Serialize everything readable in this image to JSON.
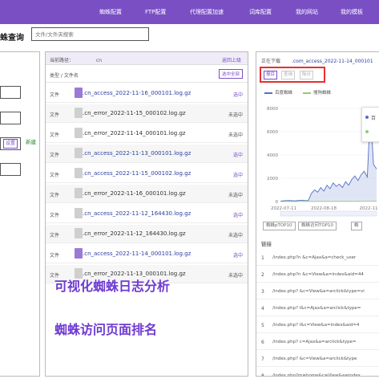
{
  "nav": {
    "items": [
      "蜘蛛配置",
      "FTP配置",
      "代理配置加速",
      "词库配置",
      "我的网站",
      "我的模板"
    ]
  },
  "page": {
    "title": "蛛查询",
    "search_placeholder": "文件/文件夹搜索"
  },
  "left_panel": {
    "settings_label": "设置",
    "new_label": "新建"
  },
  "file_panel": {
    "current_path_label": "当前路径：",
    "current_path_value": "cn",
    "back_label": "返回上级",
    "column_label": "类型 / 文件名",
    "select_all_label": "选中全部",
    "files": [
      {
        "type": "文件",
        "name": ".cn_access_2022-11-16_000101.log.gz",
        "status": "选中",
        "selected": true,
        "icon_color": "#9b7ad6"
      },
      {
        "type": "文件",
        "name": ".cn_error_2022-11-15_000102.log.gz",
        "status": "未选中",
        "selected": false,
        "icon_color": "#cfcfcf"
      },
      {
        "type": "文件",
        "name": ".cn_error_2022-11-14_000101.log.gz",
        "status": "未选中",
        "selected": false,
        "icon_color": "#cfcfcf"
      },
      {
        "type": "文件",
        "name": ".cn_access_2022-11-13_000101.log.gz",
        "status": "选中",
        "selected": true,
        "icon_color": "#cfcfcf"
      },
      {
        "type": "文件",
        "name": ".cn_access_2022-11-15_000102.log.gz",
        "status": "选中",
        "selected": true,
        "icon_color": "#cfcfcf"
      },
      {
        "type": "文件",
        "name": ".cn_error_2022-11-16_000101.log.gz",
        "status": "未选中",
        "selected": false,
        "icon_color": "#cfcfcf"
      },
      {
        "type": "文件",
        "name": ".cn_access_2022-11-12_164430.log.gz",
        "status": "选中",
        "selected": true,
        "icon_color": "#cfcfcf"
      },
      {
        "type": "文件",
        "name": ".cn_error_2022-11-12_164430.log.gz",
        "status": "未选中",
        "selected": false,
        "icon_color": "#cfcfcf"
      },
      {
        "type": "文件",
        "name": ".cn_access_2022-11-14_000101.log.gz",
        "status": "选中",
        "selected": true,
        "icon_color": "#9b7ad6"
      },
      {
        "type": "文件",
        "name": ".cn_error_2022-11-13_000101.log.gz",
        "status": "未选中",
        "selected": false,
        "icon_color": "#cfcfcf"
      }
    ]
  },
  "overlay": {
    "line1": "可视化蜘蛛日志分析",
    "line2": "蜘蛛访问页面排名"
  },
  "right_panel": {
    "downloading_label": "正在下载",
    "downloading_file": ".com_access_2022-11-14_000101",
    "buttons": [
      "报目",
      "查询",
      "除分"
    ],
    "legend": [
      "百度蜘蛛",
      "搜狗蜘蛛"
    ],
    "rank_buttons": [
      "蜘蛛pTOP10",
      "蜘蛛访问TOP10",
      "蜘"
    ],
    "links_title": "链接",
    "links": [
      {
        "num": "1",
        "url": "/index.php?n    &c=Ajax&a=check_user"
      },
      {
        "num": "2",
        "url": "/index.php?n    &c=View&a=index&aid=44"
      },
      {
        "num": "3",
        "url": "/index.php?    &c=View&a=arclick&type=vi"
      },
      {
        "num": "4",
        "url": "/index.php?    l&c=Ajax&a=arclick&type="
      },
      {
        "num": "5",
        "url": "/index.php?    l&c=View&a=index&aid=4"
      },
      {
        "num": "6",
        "url": "/index.php?    c=Ajax&a=arclick&type="
      },
      {
        "num": "7",
        "url": "/index.php?    &c=View&a=arclick&type"
      },
      {
        "num": "8",
        "url": "/index.php?m=home&c=View&a=index"
      }
    ],
    "colors": {
      "accent": "#7a4fc4",
      "baidu": "#5470c6",
      "sogou": "#91cc75",
      "highlight": "#e53030"
    }
  },
  "chart_data": {
    "type": "line",
    "x": [
      "2022-07-11",
      "2022-08-18",
      "2022-11"
    ],
    "ylim": [
      0,
      8000
    ],
    "yticks": [
      0,
      2000,
      4000,
      6000,
      8000
    ],
    "series": [
      {
        "name": "百度蜘蛛",
        "values": [
          40,
          60,
          80,
          90,
          60,
          70,
          100,
          120,
          80,
          90,
          700,
          1000,
          800,
          1200,
          900,
          1400,
          1100,
          1600,
          1300,
          1500,
          1200,
          1700,
          1400,
          1900,
          2200,
          1800,
          2300,
          2600,
          2100,
          7900,
          3200,
          2800
        ]
      },
      {
        "name": "搜狗蜘蛛",
        "values": [
          5,
          8,
          10,
          6,
          9,
          12,
          10,
          8,
          11,
          14,
          12,
          10,
          13,
          15,
          12,
          14,
          16,
          13,
          15,
          17,
          14,
          16,
          18,
          15,
          17,
          19,
          16,
          18,
          20,
          22,
          19,
          21
        ]
      }
    ]
  }
}
